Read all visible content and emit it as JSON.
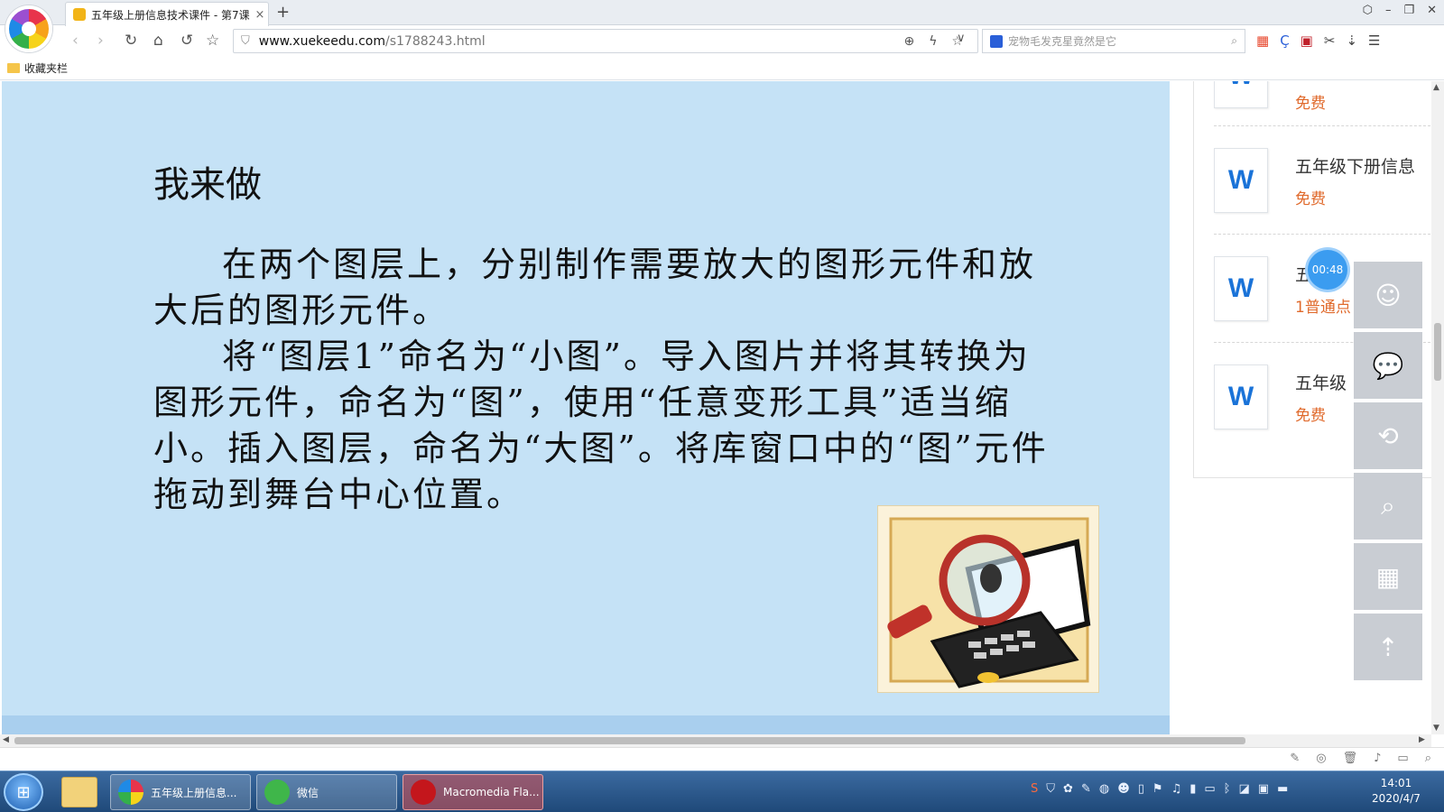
{
  "browser": {
    "tab_title": "五年级上册信息技术课件 - 第7课",
    "tab_close": "×",
    "new_tab": "+",
    "url_host": "www.xuekeedu.com",
    "url_path": "/s1788243.html",
    "search_placeholder": "宠物毛发克星竟然是它",
    "bookmarks_label": "收藏夹栏"
  },
  "slide": {
    "heading": "我来做",
    "paragraph1": "在两个图层上，分别制作需要放大的图形元件和放大后的图形元件。",
    "paragraph2": "将“图层1”命名为“小图”。导入图片并将其转换为图形元件，命名为“图”，使用“任意变形工具”适当缩小。插入图层，命名为“大图”。将库窗口中的“图”元件拖动到舞台中心位置。"
  },
  "sidebar": {
    "docs": [
      {
        "icon": "W",
        "title": "",
        "price": "免费"
      },
      {
        "icon": "W",
        "title": "五年级下册信息",
        "price": "免费"
      },
      {
        "icon": "W",
        "title": "五",
        "price": "1普通点"
      },
      {
        "icon": "W",
        "title": "五年级",
        "price": "免费"
      }
    ]
  },
  "timer": "00:48",
  "taskbar": {
    "items": [
      {
        "label": "五年级上册信息..."
      },
      {
        "label": "微信"
      },
      {
        "label": "Macromedia Fla..."
      }
    ],
    "clock_time": "14:01",
    "clock_date": "2020/4/7"
  },
  "colors": {
    "slide_bg": "#c5e2f6",
    "price": "#e06a2c",
    "word_blue": "#1a73d8"
  }
}
